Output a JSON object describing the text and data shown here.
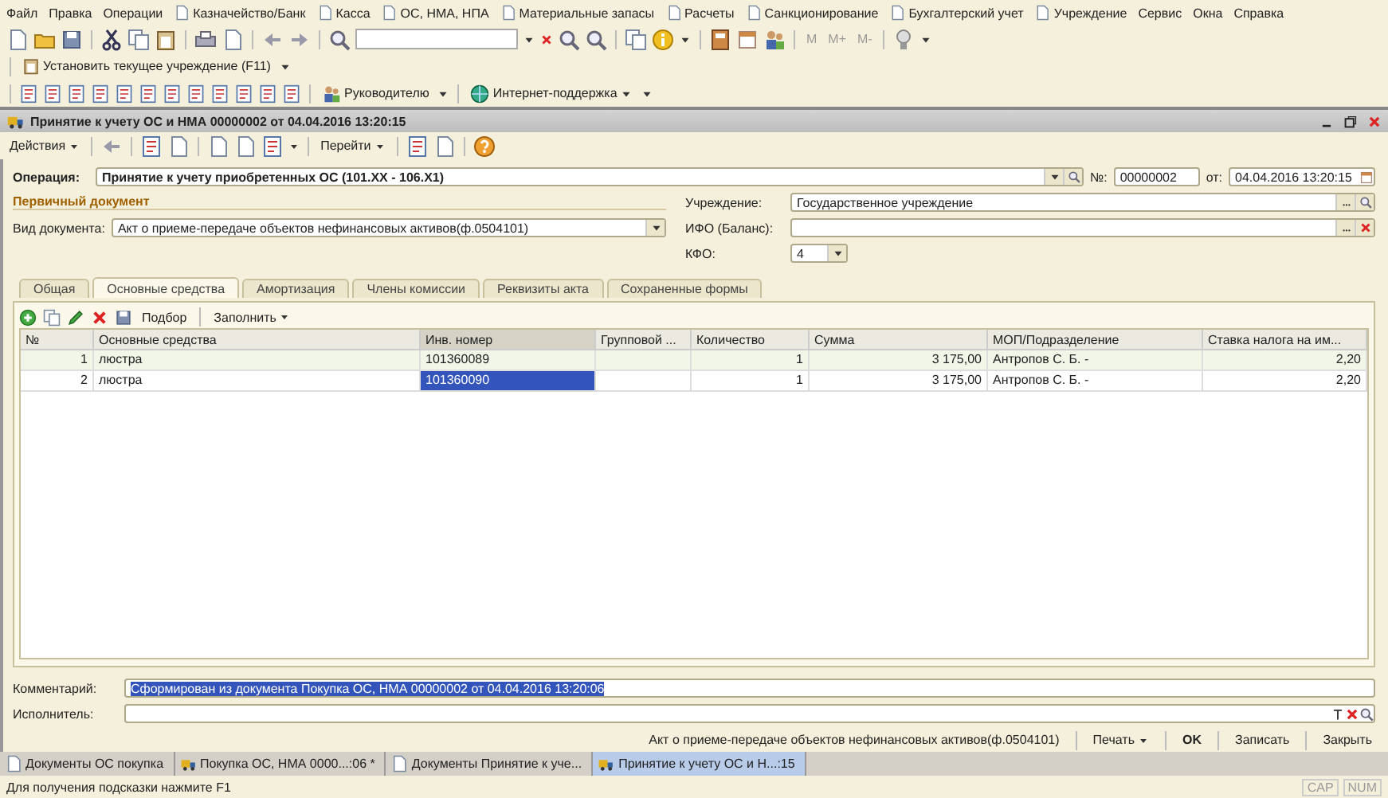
{
  "menu": [
    {
      "label": "Файл",
      "has_icon": false
    },
    {
      "label": "Правка",
      "has_icon": false
    },
    {
      "label": "Операции",
      "has_icon": false
    },
    {
      "label": "Казначейство/Банк",
      "has_icon": true
    },
    {
      "label": "Касса",
      "has_icon": true
    },
    {
      "label": "ОС, НМА, НПА",
      "has_icon": true
    },
    {
      "label": "Материальные запасы",
      "has_icon": true
    },
    {
      "label": "Расчеты",
      "has_icon": true
    },
    {
      "label": "Санкционирование",
      "has_icon": true
    },
    {
      "label": "Бухгалтерский учет",
      "has_icon": true
    },
    {
      "label": "Учреждение",
      "has_icon": true
    },
    {
      "label": "Сервис",
      "has_icon": false
    },
    {
      "label": "Окна",
      "has_icon": false
    },
    {
      "label": "Справка",
      "has_icon": false
    }
  ],
  "toolbar": {
    "memory_buttons": [
      {
        "label": "M",
        "disabled": true
      },
      {
        "label": "M+",
        "disabled": true
      },
      {
        "label": "M-",
        "disabled": true
      }
    ]
  },
  "institution_toolbar": {
    "button": "Установить текущее учреждение (F11)"
  },
  "reports_toolbar": {
    "manager_button": "Руководителю",
    "support_button": "Интернет-поддержка"
  },
  "window": {
    "title": "Принятие к учету ОС и НМА 00000002 от 04.04.2016 13:20:15"
  },
  "actions": {
    "actions_menu": "Действия",
    "goto_menu": "Перейти"
  },
  "form": {
    "operation_label": "Операция:",
    "operation": "Принятие к учету приобретенных ОС (101.XX - 106.X1)",
    "number_label": "№:",
    "number": "00000002",
    "date_label": "от:",
    "date": "04.04.2016 13:20:15",
    "section_title": "Первичный документ",
    "doc_type_label": "Вид документа:",
    "doc_type": "Акт о приеме-передаче объектов нефинансовых активов(ф.0504101)",
    "institution_label": "Учреждение:",
    "institution": "Государственное учреждение",
    "ifo_label": "ИФО (Баланс):",
    "kfo_label": "КФО:",
    "kfo": "4"
  },
  "tabs": [
    {
      "label": "Общая",
      "selected": false
    },
    {
      "label": "Основные средства",
      "selected": true
    },
    {
      "label": "Амортизация",
      "selected": false
    },
    {
      "label": "Члены комиссии",
      "selected": false
    },
    {
      "label": "Реквизиты акта",
      "selected": false
    },
    {
      "label": "Сохраненные формы",
      "selected": false
    }
  ],
  "table_toolbar": {
    "pick_button": "Подбор",
    "fill_menu": "Заполнить"
  },
  "table": {
    "columns": [
      {
        "label": "№",
        "selected": false
      },
      {
        "label": "Основные средства",
        "selected": false
      },
      {
        "label": "Инв. номер",
        "selected": true
      },
      {
        "label": "Групповой ...",
        "selected": false
      },
      {
        "label": "Количество",
        "selected": false
      },
      {
        "label": "Сумма",
        "selected": false
      },
      {
        "label": "МОП/Подразделение",
        "selected": false
      },
      {
        "label": "Ставка налога на им...",
        "selected": false
      }
    ],
    "rows": [
      {
        "cells": [
          "1",
          "люстра",
          "101360089",
          "",
          "1",
          "3 175,00",
          "Антропов С. Б. -",
          "2,20"
        ],
        "selected": false
      },
      {
        "cells": [
          "2",
          "люстра",
          "101360090",
          "",
          "1",
          "3 175,00",
          "Антропов С. Б. -",
          "2,20"
        ],
        "selected": true
      }
    ]
  },
  "comment": {
    "label": "Комментарий:",
    "value": "Сформирован из документа Покупка ОС, НМА 00000002 от 04.04.2016 13:20:06",
    "selected": true
  },
  "executor": {
    "label": "Исполнитель:"
  },
  "bottom_bar": {
    "print_form": "Акт о приеме-передаче объектов нефинансовых активов(ф.0504101)",
    "print_menu": "Печать",
    "ok": "OK",
    "save": "Записать",
    "close": "Закрыть"
  },
  "taskbar": [
    {
      "label": "Документы ОС покупка",
      "selected": false
    },
    {
      "label": "Покупка ОС, НМА 0000...:06 *",
      "selected": false
    },
    {
      "label": "Документы Принятие к уче...",
      "selected": false
    },
    {
      "label": "Принятие к учету ОС и Н...:15",
      "selected": true
    }
  ],
  "status_bar": {
    "hint": "Для получения подсказки нажмите F1",
    "caps": "CAP",
    "num": "NUM"
  }
}
